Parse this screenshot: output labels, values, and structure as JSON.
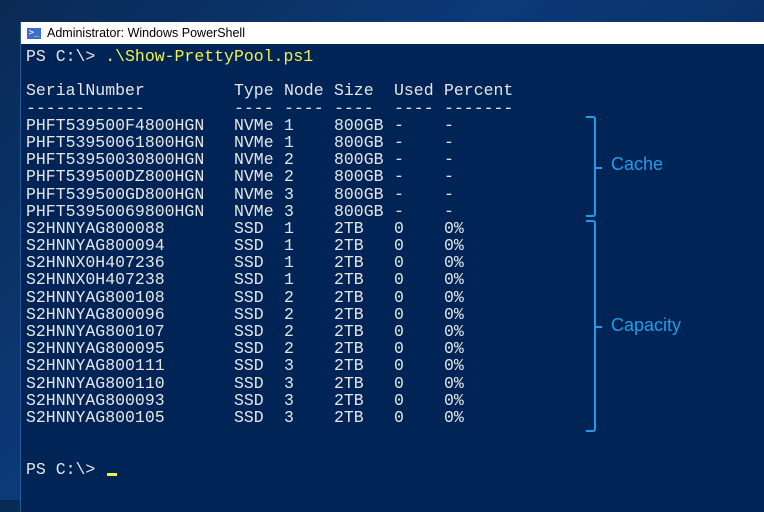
{
  "window": {
    "title": "Administrator: Windows PowerShell"
  },
  "console": {
    "prompt": "PS C:\\> ",
    "command": ".\\Show-PrettyPool.ps1",
    "headers": [
      "SerialNumber",
      "Type",
      "Node",
      "Size",
      "Used",
      "Percent"
    ],
    "dashes": [
      "------------",
      "----",
      "----",
      "----",
      "----",
      "-------"
    ],
    "rows": [
      [
        "PHFT539500F4800HGN",
        "NVMe",
        "1",
        "800GB",
        "-",
        "-"
      ],
      [
        "PHFT53950061800HGN",
        "NVMe",
        "1",
        "800GB",
        "-",
        "-"
      ],
      [
        "PHFT53950030800HGN",
        "NVMe",
        "2",
        "800GB",
        "-",
        "-"
      ],
      [
        "PHFT539500DZ800HGN",
        "NVMe",
        "2",
        "800GB",
        "-",
        "-"
      ],
      [
        "PHFT539500GD800HGN",
        "NVMe",
        "3",
        "800GB",
        "-",
        "-"
      ],
      [
        "PHFT53950069800HGN",
        "NVMe",
        "3",
        "800GB",
        "-",
        "-"
      ],
      [
        "S2HNNYAG800088",
        "SSD",
        "1",
        "2TB",
        "0",
        "0%"
      ],
      [
        "S2HNNYAG800094",
        "SSD",
        "1",
        "2TB",
        "0",
        "0%"
      ],
      [
        "S2HNNX0H407236",
        "SSD",
        "1",
        "2TB",
        "0",
        "0%"
      ],
      [
        "S2HNNX0H407238",
        "SSD",
        "1",
        "2TB",
        "0",
        "0%"
      ],
      [
        "S2HNNYAG800108",
        "SSD",
        "2",
        "2TB",
        "0",
        "0%"
      ],
      [
        "S2HNNYAG800096",
        "SSD",
        "2",
        "2TB",
        "0",
        "0%"
      ],
      [
        "S2HNNYAG800107",
        "SSD",
        "2",
        "2TB",
        "0",
        "0%"
      ],
      [
        "S2HNNYAG800095",
        "SSD",
        "2",
        "2TB",
        "0",
        "0%"
      ],
      [
        "S2HNNYAG800111",
        "SSD",
        "3",
        "2TB",
        "0",
        "0%"
      ],
      [
        "S2HNNYAG800110",
        "SSD",
        "3",
        "2TB",
        "0",
        "0%"
      ],
      [
        "S2HNNYAG800093",
        "SSD",
        "3",
        "2TB",
        "0",
        "0%"
      ],
      [
        "S2HNNYAG800105",
        "SSD",
        "3",
        "2TB",
        "0",
        "0%"
      ]
    ],
    "final_prompt": "PS C:\\> "
  },
  "annotations": {
    "cache": "Cache",
    "capacity": "Capacity",
    "color": "#1e9de8"
  }
}
